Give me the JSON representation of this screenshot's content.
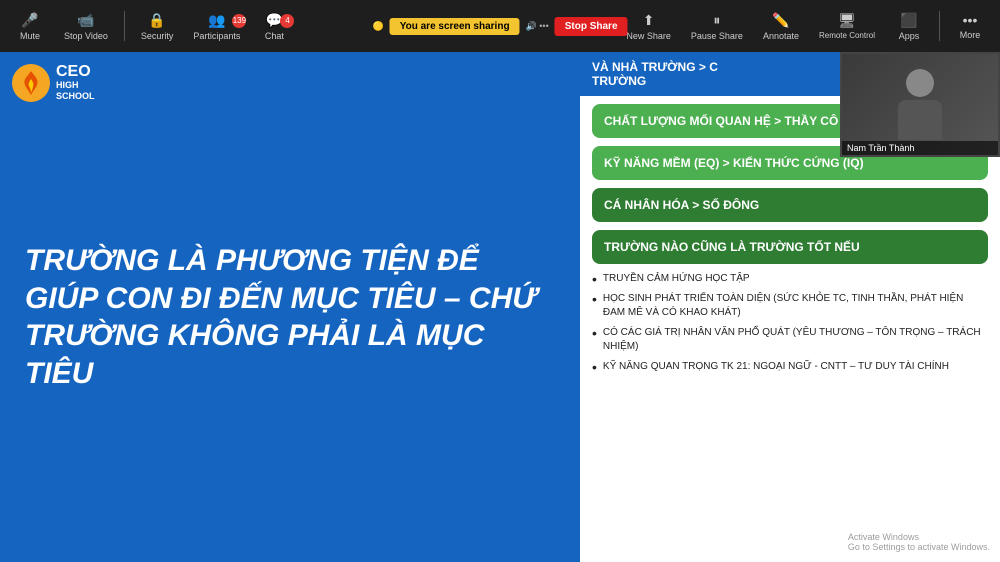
{
  "toolbar": {
    "mute_label": "Mute",
    "stop_video_label": "Stop Video",
    "security_label": "Security",
    "participants_label": "Participants",
    "participants_count": "139",
    "chat_label": "Chat",
    "chat_count": "4",
    "new_share_label": "New Share",
    "pause_share_label": "Pause Share",
    "annotate_label": "Annotate",
    "remote_control_label": "Remote Control",
    "apps_label": "Apps",
    "more_label": "More",
    "screen_sharing_text": "You are screen sharing",
    "stop_share_text": "Stop Share"
  },
  "slide": {
    "logo_ceo": "CEO",
    "logo_high": "HIGH",
    "logo_school": "SCHOOL",
    "main_text": "TRƯỜNG LÀ PHƯƠNG TIỆN ĐỂ GIÚP CON ĐI ĐẾN MỤC TIÊU – CHỨ TRƯỜNG KHÔNG PHẢI LÀ MỤC TIÊU"
  },
  "right_panel": {
    "header": "TRƯỜNG",
    "box1": "CHẤT LƯỢNG MỐI QUAN HỆ > THẦY CÔ NGHIÊM KHẮC",
    "box2": "KỸ NĂNG MỀM (EQ) > KIẾN THỨC CỨNG (IQ)",
    "box3": "CÁ NHÂN HÓA > SỐ ĐÔNG",
    "box4": "TRƯỜNG NÀO CŨNG LÀ TRƯỜNG TỐT NẾU",
    "bullets": [
      "TRUYỀN CẢM HỨNG HỌC TẬP",
      "HỌC SINH PHÁT TRIỂN TOÀN DIỆN (SỨC KHỎE TC, TINH THẦN, PHÁT HIỆN ĐAM MÊ VÀ CÓ KHAO KHÁT)",
      "CÓ CÁC GIÁ TRỊ NHÂN VĂN PHỔ QUÁT (YÊU THƯƠNG – TÔN TRỌNG – TRÁCH NHIỆM)",
      "KỸ NĂNG QUAN TRỌNG TK 21: NGOẠI NGỮ - CNTT – TƯ DUY TÀI CHÍNH"
    ],
    "speaker_name": "Nam Trần Thành",
    "activate_text": "Activate Windows",
    "activate_sub": "Go to Settings to activate Windows."
  },
  "header_right_title": "VÀ NHÀ TRƯỜNG > C"
}
